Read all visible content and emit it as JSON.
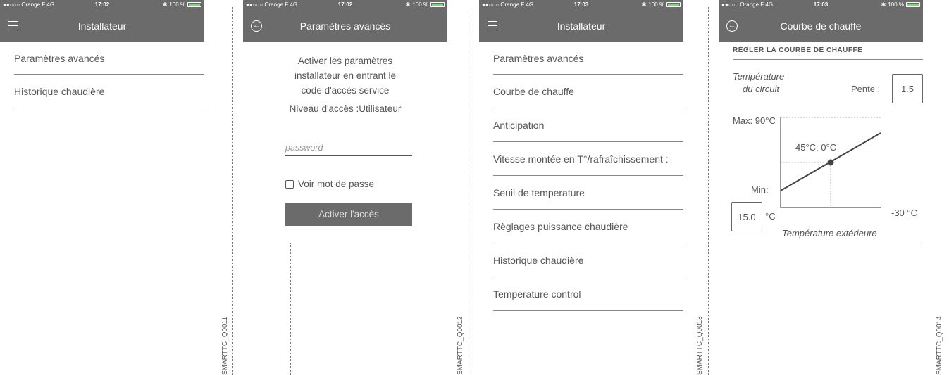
{
  "status": {
    "carrier": "●●○○○ Orange F  4G",
    "battery": "100 %",
    "bluetooth": "bluetooth-icon",
    "times": [
      "17:02",
      "17:02",
      "17:03",
      "17:03"
    ]
  },
  "screen1": {
    "title": "Installateur",
    "items": [
      "Paramètres avancés",
      "Historique chaudière"
    ],
    "code": "SMARTTC_Q0011"
  },
  "screen2": {
    "title": "Paramètres avancés",
    "description_lines": [
      "Activer les paramètres",
      "installateur en entrant le",
      "code d'accès service"
    ],
    "access_level": "Niveau d'accès :Utilisateur",
    "password_placeholder": "password",
    "show_password": "Voir mot de passe",
    "activate_button": "Activer l'accès",
    "code": "SMARTTC_Q0012"
  },
  "screen3": {
    "title": "Installateur",
    "items": [
      "Paramètres avancés",
      "Courbe de chauffe",
      "Anticipation",
      "Vitesse montée en T°/rafraîchissement :",
      "Seuil de temperature",
      "Règlages puissance chaudière",
      "Historique chaudière",
      "Temperature control"
    ],
    "code": "SMARTTC_Q0013"
  },
  "screen4": {
    "title": "Courbe de chauffe",
    "section": "RÉGLER LA COURBE DE CHAUFFE",
    "circuit_label_1": "Température",
    "circuit_label_2": "du circuit",
    "slope_label": "Pente :",
    "slope_value": "1.5",
    "max_label": "Max: 90°C",
    "point_label": "45°C; 0°C",
    "min_label": "Min:",
    "min_value": "15.0",
    "min_unit": "°C",
    "outdoor_min": "-30 °C",
    "outdoor_label": "Température extérieure",
    "code": "SMARTTC_Q0014"
  },
  "colors": {
    "header": "#6b6b6b",
    "text": "#555555",
    "button": "#6b6b6b",
    "battery": "#6ee06e"
  }
}
